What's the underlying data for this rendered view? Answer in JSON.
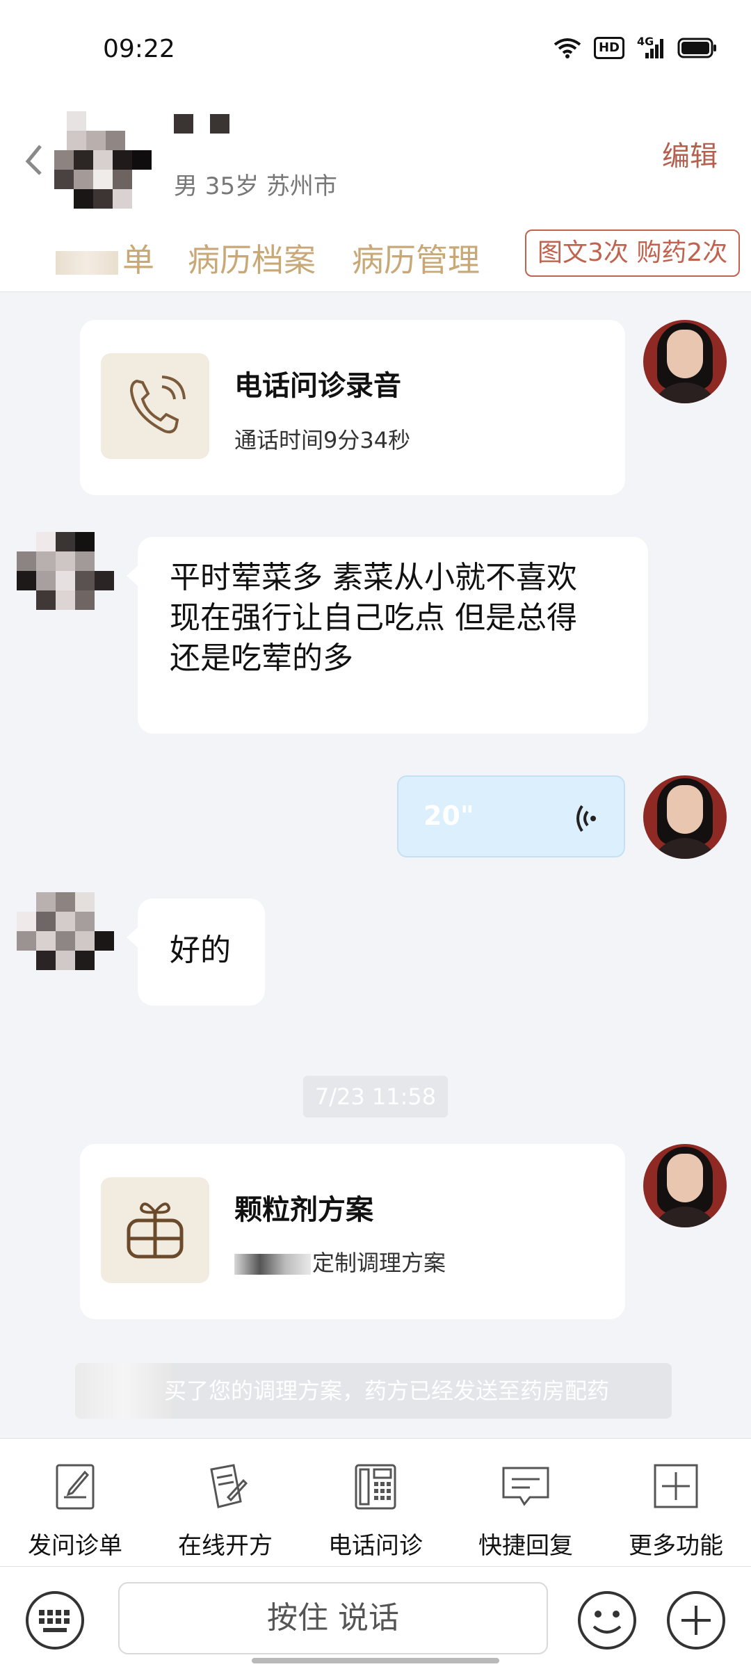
{
  "status_bar": {
    "time": "09:22",
    "hd": "HD",
    "network": "4G"
  },
  "header": {
    "patient_info": "男 35岁  苏州市",
    "edit": "编辑",
    "tabs": {
      "tab1_visible": "单",
      "tab2": "病历档案",
      "tab3": "病历管理"
    },
    "quota": "图文3次 购药2次"
  },
  "chat": {
    "call_card": {
      "title": "电话问诊录音",
      "subtitle": "通话时间9分34秒"
    },
    "patient_msg_1": [
      "平时荤菜多 素菜从小就不喜欢",
      "现在强行让自己吃点 但是总得",
      "还是吃荤的多"
    ],
    "voice_msg": {
      "duration": "20\""
    },
    "patient_msg_2": "好的",
    "timestamp": "7/23 11:58",
    "plan_card": {
      "title": "颗粒剂方案",
      "subtitle_visible": "定制调理方案"
    },
    "system_notice_visible": "买了您的调理方案，药方已经发送至药房配药"
  },
  "functions": [
    "发问诊单",
    "在线开方",
    "电话问诊",
    "快捷回复",
    "更多功能"
  ],
  "input": {
    "hold_to_talk": "按住 说话"
  },
  "colors": {
    "accent_gold": "#c9a877",
    "accent_red": "#c0624e",
    "voice_bg": "#dceffd"
  }
}
